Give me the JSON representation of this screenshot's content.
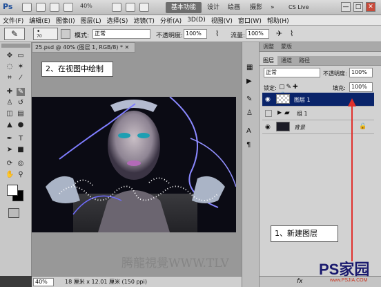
{
  "titlebar": {
    "app_logo": "Ps",
    "zoom": "40%",
    "workspace_active": "基本功能",
    "workspaces": [
      "设计",
      "绘画",
      "摄影",
      "»"
    ],
    "cs_live": "CS Live",
    "window_buttons": [
      "—",
      "□",
      "✕"
    ]
  },
  "menubar": {
    "items": [
      "文件(F)",
      "编辑(E)",
      "图像(I)",
      "图层(L)",
      "选择(S)",
      "滤镜(T)",
      "分析(A)",
      "3D(D)",
      "视图(V)",
      "窗口(W)",
      "帮助(H)"
    ]
  },
  "optionsbar": {
    "brush_size": "70",
    "mode_label": "模式:",
    "mode_value": "正常",
    "opacity_label": "不透明度:",
    "opacity_value": "100%",
    "flow_label": "流量:",
    "flow_value": "100%"
  },
  "document": {
    "tab_title": "25.psd @ 40% (图层 1, RGB/8) * ✕",
    "status_zoom": "40%",
    "status_info": "18 厘米 x 12.01 厘米 (150 ppi)"
  },
  "callouts": {
    "draw_in_view": "2、在视图中绘制",
    "new_layer": "1、新建图层"
  },
  "panel": {
    "top_tabs": [
      "调整",
      "蒙版"
    ],
    "layer_tabs": [
      "图层",
      "通道",
      "路径"
    ],
    "blend_mode": "正常",
    "opacity_label": "不透明度:",
    "opacity_value": "100%",
    "lock_label": "锁定:",
    "fill_label": "填充:",
    "fill_value": "100%",
    "layers": [
      {
        "name": "图层 1",
        "selected": true
      },
      {
        "name": "组 1",
        "selected": false
      },
      {
        "name": "背景",
        "selected": false
      }
    ]
  },
  "watermark": {
    "text": "腾龍視覺WWW.TLV",
    "site": "PS家园",
    "url": "www.PSJIA.COM"
  },
  "colors": {
    "selected_layer": "#0a246a",
    "arrow": "#e0302c",
    "ws_active": "#6e6e6e"
  }
}
